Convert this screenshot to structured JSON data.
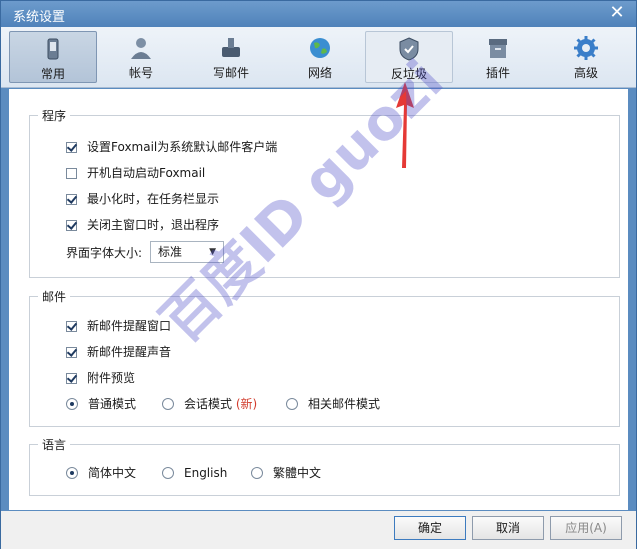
{
  "window": {
    "title": "系统设置"
  },
  "tabs": [
    {
      "label": "常用",
      "icon": "phone-icon"
    },
    {
      "label": "帐号",
      "icon": "user-icon"
    },
    {
      "label": "写邮件",
      "icon": "compose-icon"
    },
    {
      "label": "网络",
      "icon": "globe-icon"
    },
    {
      "label": "反垃圾",
      "icon": "shield-icon"
    },
    {
      "label": "插件",
      "icon": "box-icon"
    },
    {
      "label": "高级",
      "icon": "gear-icon"
    }
  ],
  "program": {
    "title": "程序",
    "items": [
      {
        "label": "设置Foxmail为系统默认邮件客户端",
        "checked": true
      },
      {
        "label": "开机自动启动Foxmail",
        "checked": false
      },
      {
        "label": "最小化时，在任务栏显示",
        "checked": true
      },
      {
        "label": "关闭主窗口时，退出程序",
        "checked": true
      }
    ],
    "font_size_label": "界面字体大小:",
    "font_size_value": "标准"
  },
  "mail": {
    "title": "邮件",
    "items": [
      {
        "label": "新邮件提醒窗口",
        "checked": true
      },
      {
        "label": "新邮件提醒声音",
        "checked": true
      },
      {
        "label": "附件预览",
        "checked": true
      }
    ],
    "modes": [
      {
        "label": "普通模式",
        "selected": true
      },
      {
        "label": "会话模式",
        "selected": false
      },
      {
        "label": "相关邮件模式",
        "selected": false
      }
    ],
    "new_tag": "(新)"
  },
  "language": {
    "title": "语言",
    "options": [
      {
        "label": "简体中文",
        "selected": true
      },
      {
        "label": "English",
        "selected": false
      },
      {
        "label": "繁體中文",
        "selected": false
      }
    ]
  },
  "footer": {
    "ok": "确定",
    "cancel": "取消",
    "apply": "应用(A)"
  },
  "watermark": "百度ID guozi",
  "colors": {
    "title_bar": "#5b8cc0",
    "accent": "#d23b2c",
    "annotation_arrow": "#e53935"
  }
}
